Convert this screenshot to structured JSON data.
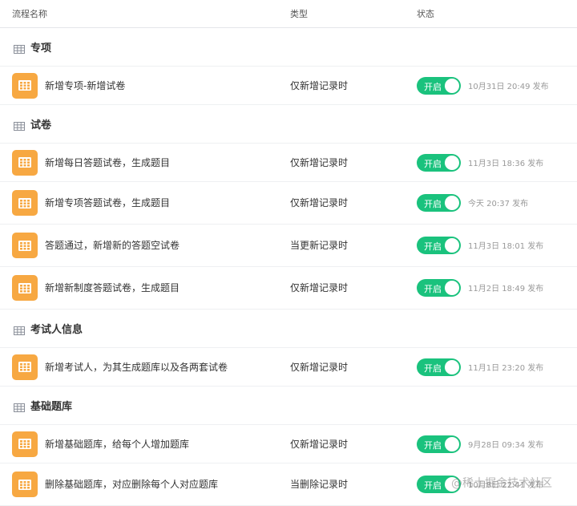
{
  "header": {
    "name": "流程名称",
    "type": "类型",
    "status": "状态"
  },
  "colors": {
    "accent_green": "#1ac27d",
    "icon_orange": "#f7a842"
  },
  "groups": [
    {
      "title": "专项",
      "icon": "table-icon",
      "rows": [
        {
          "name": "新增专项-新增试卷",
          "type": "仅新增记录时",
          "toggle": "开启",
          "time": "10月31日 20:49 发布"
        }
      ]
    },
    {
      "title": "试卷",
      "icon": "table-icon",
      "rows": [
        {
          "name": "新增每日答题试卷，生成题目",
          "type": "仅新增记录时",
          "toggle": "开启",
          "time": "11月3日 18:36 发布"
        },
        {
          "name": "新增专项答题试卷，生成题目",
          "type": "仅新增记录时",
          "toggle": "开启",
          "time": "今天 20:37 发布"
        },
        {
          "name": "答题通过，新增新的答题空试卷",
          "type": "当更新记录时",
          "toggle": "开启",
          "time": "11月3日 18:01 发布"
        },
        {
          "name": "新增新制度答题试卷，生成题目",
          "type": "仅新增记录时",
          "toggle": "开启",
          "time": "11月2日 18:49 发布"
        }
      ]
    },
    {
      "title": "考试人信息",
      "icon": "table-icon",
      "rows": [
        {
          "name": "新增考试人，为其生成题库以及各两套试卷",
          "type": "仅新增记录时",
          "toggle": "开启",
          "time": "11月1日 23:20 发布"
        }
      ]
    },
    {
      "title": "基础题库",
      "icon": "table-icon",
      "rows": [
        {
          "name": "新增基础题库，给每个人增加题库",
          "type": "仅新增记录时",
          "toggle": "开启",
          "time": "9月28日 09:34 发布"
        },
        {
          "name": "删除基础题库，对应删除每个人对应题库",
          "type": "当删除记录时",
          "toggle": "开启",
          "time": "10月8日 22:41 发布"
        }
      ]
    }
  ],
  "watermark": "@稀土掘金技术社区"
}
